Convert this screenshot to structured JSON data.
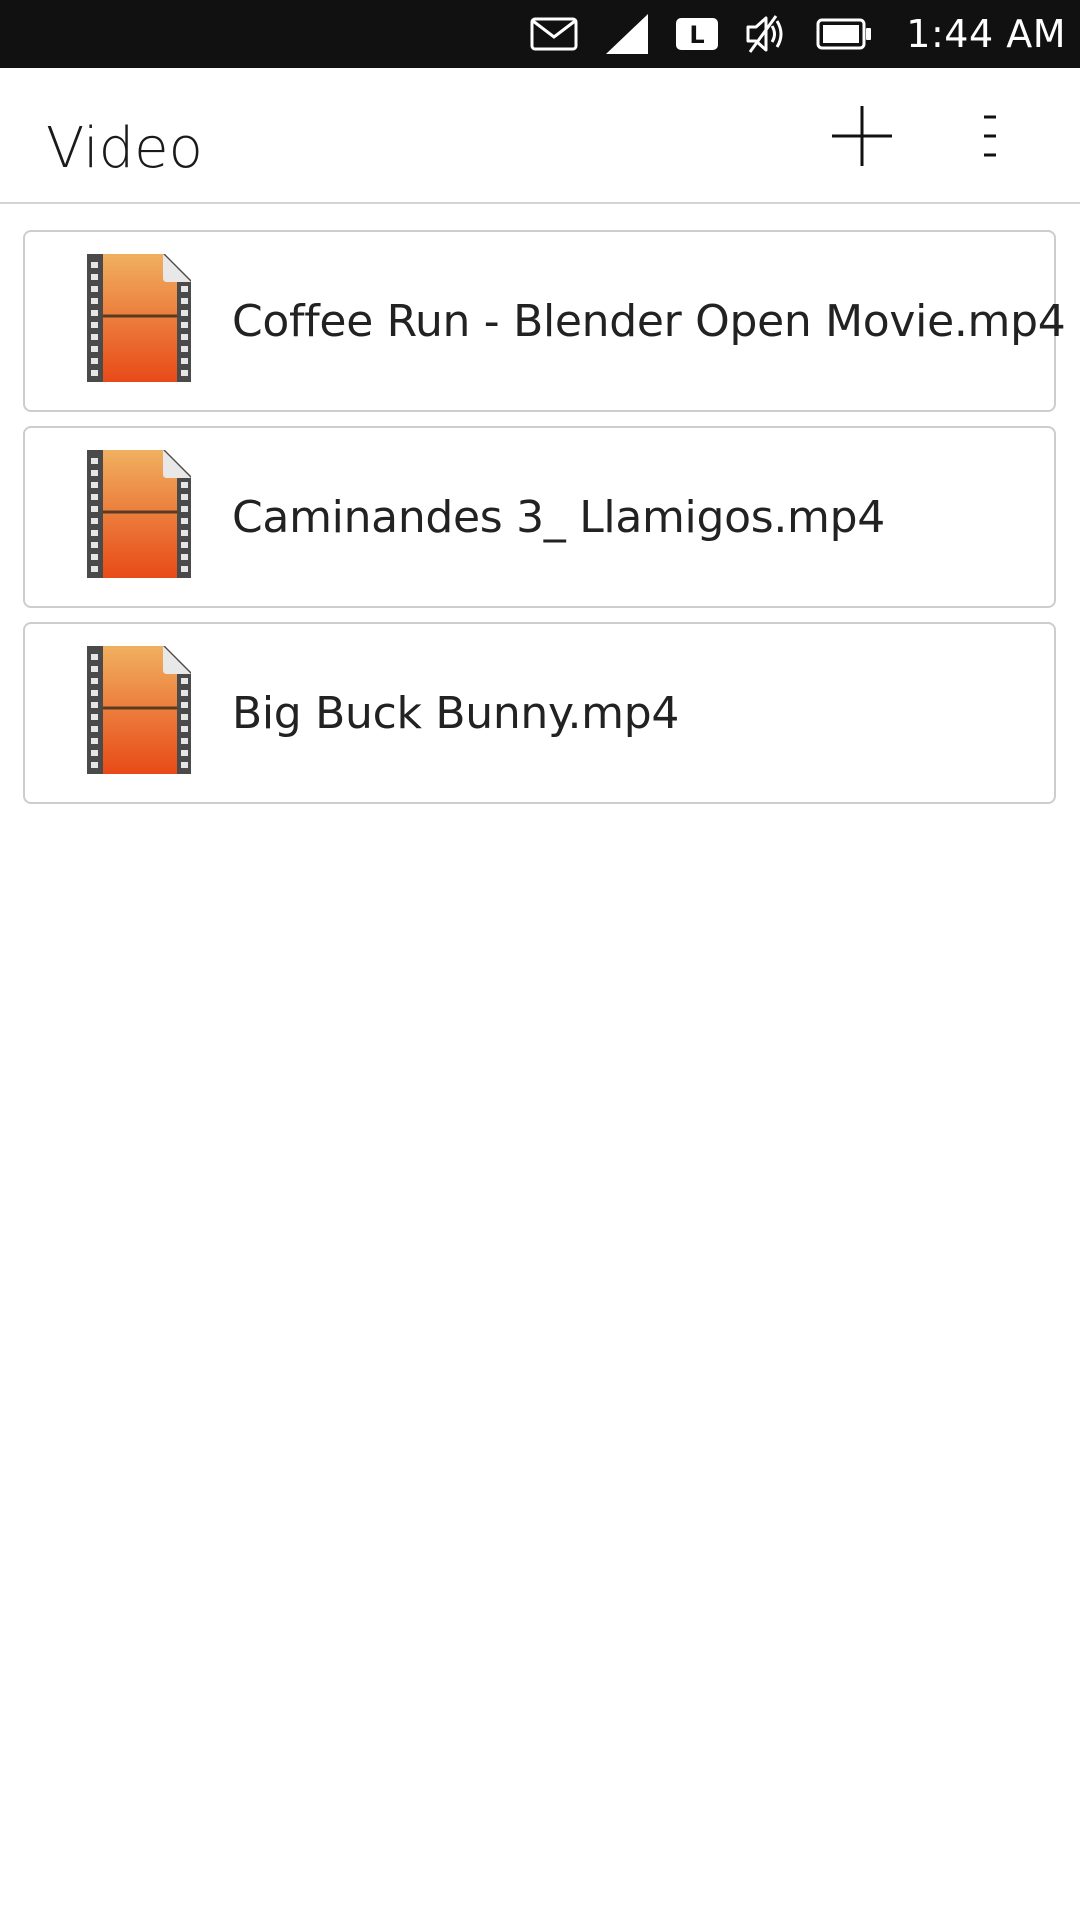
{
  "status_bar": {
    "icons": [
      "mail-icon",
      "signal-icon",
      "network-l-icon",
      "muted-speaker-icon",
      "battery-icon"
    ],
    "network_label": "L",
    "time": "1:44 AM"
  },
  "header": {
    "title": "Video",
    "actions": [
      "add-icon",
      "overflow-menu-icon"
    ]
  },
  "files": [
    {
      "name": "Coffee Run - Blender Open Movie.mp4",
      "icon": "video-file-icon"
    },
    {
      "name": "Caminandes 3_ Llamigos.mp4",
      "icon": "video-file-icon"
    },
    {
      "name": "Big Buck Bunny.mp4",
      "icon": "video-file-icon"
    }
  ],
  "colors": {
    "status_bar_bg": "#111111",
    "divider": "#d4d4d4",
    "card_border": "#cdcdcd",
    "icon_orange_top": "#f0b060",
    "icon_orange_bottom": "#e84a18"
  }
}
